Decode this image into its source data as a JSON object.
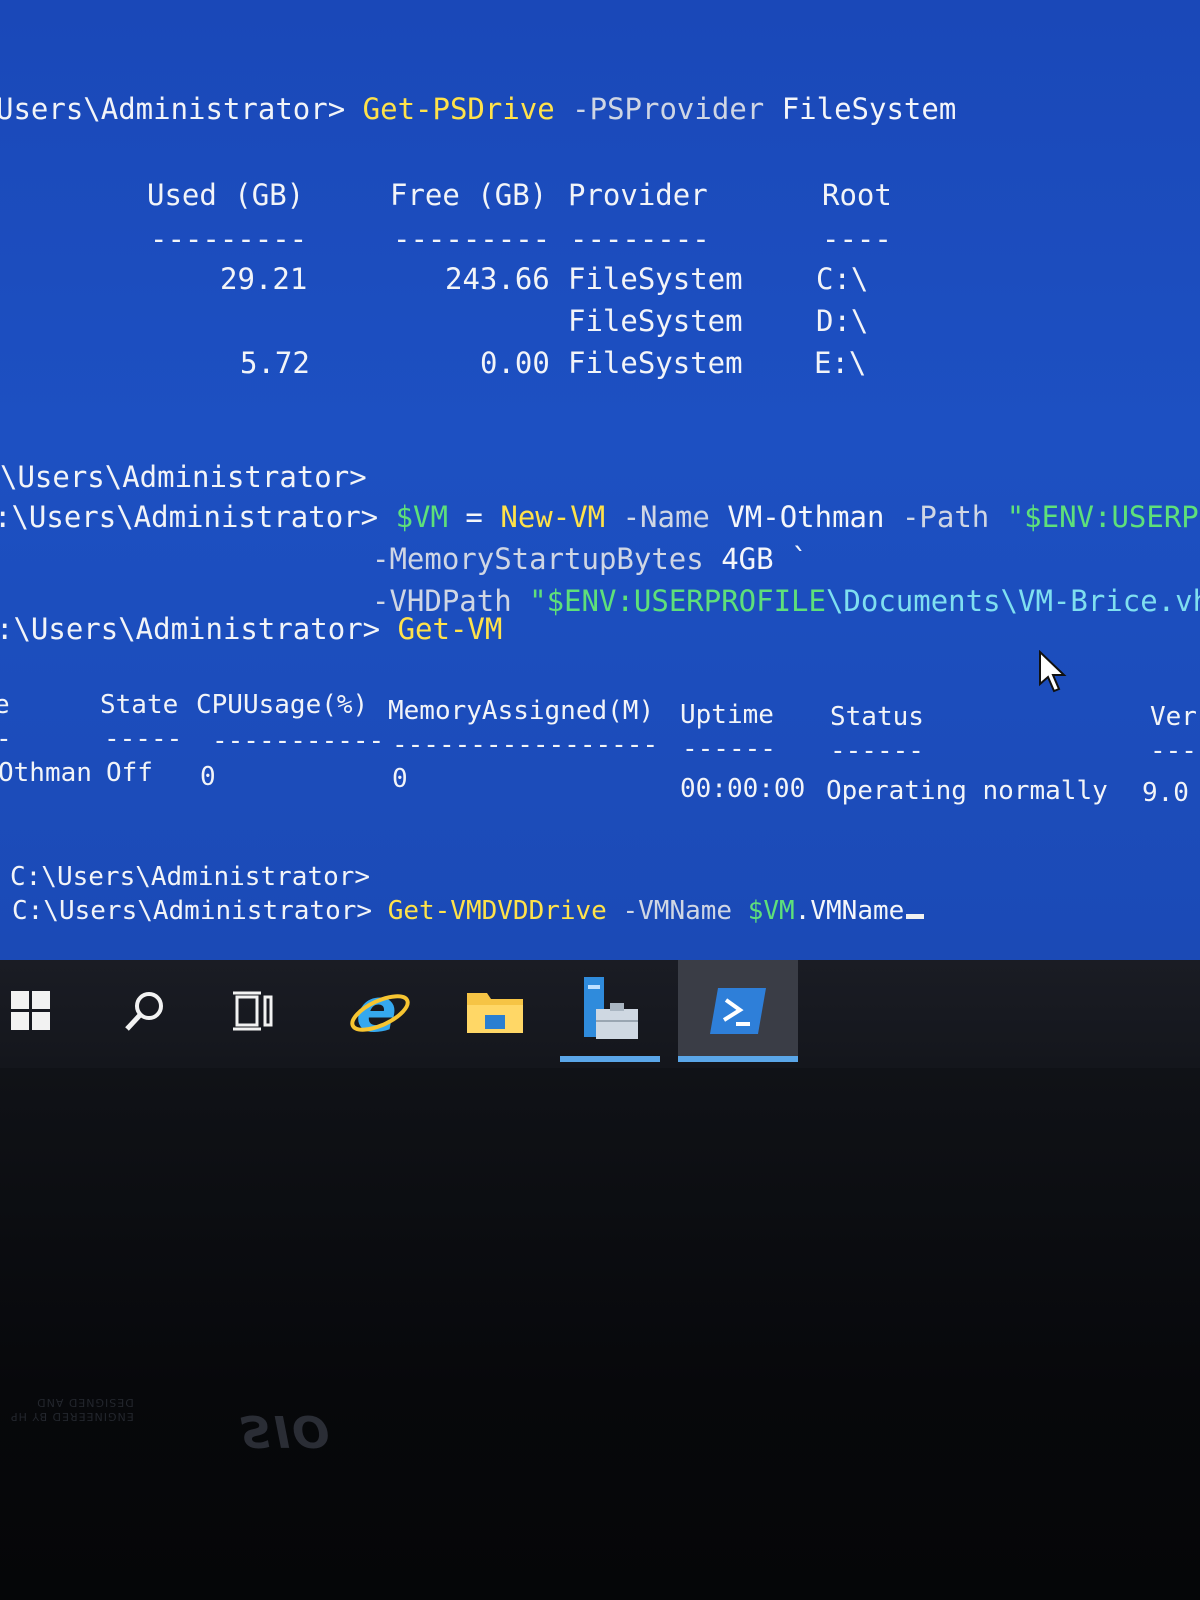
{
  "terminal": {
    "psdrive": {
      "prompt": "Users\\Administrator> ",
      "cmd": "Get-PSDrive",
      "param": " -PSProvider ",
      "arg": "FileSystem",
      "headers": {
        "used": "Used (GB)",
        "free": "Free (GB)",
        "provider": "Provider",
        "root": "Root"
      },
      "separators": {
        "used": "---------",
        "free": "---------",
        "provider": "--------",
        "root": "----"
      },
      "rows": [
        {
          "used": "29.21",
          "free": "243.66",
          "provider": "FileSystem",
          "root": "C:\\"
        },
        {
          "used": "",
          "free": "",
          "provider": "FileSystem",
          "root": "D:\\"
        },
        {
          "used": "5.72",
          "free": "0.00",
          "provider": "FileSystem",
          "root": "E:\\"
        }
      ]
    },
    "blank_prompt_1": "\\Users\\Administrator>",
    "newvm": {
      "prompt": ":\\Users\\Administrator> ",
      "var": "$VM",
      "eq": " = ",
      "cmd": "New-VM",
      "p1": " -Name ",
      "a1": "VM-Othman",
      "p2": " -Path ",
      "a2": "\"$ENV:USERPROF",
      "line2_param": "-MemoryStartupBytes ",
      "line2_arg": "4GB",
      "line2_tick": " `",
      "line3_param": "-VHDPath ",
      "line3_arg_a": "\"$ENV:USERPROFILE",
      "line3_arg_b": "\\Documents\\VM-Brice.vhd"
    },
    "getvm": {
      "prompt": ":\\Users\\Administrator> ",
      "cmd": "Get-VM",
      "headers": {
        "name": "e",
        "state": "State",
        "cpu": "CPUUsage(%)",
        "mem": "MemoryAssigned(M)",
        "uptime": "Uptime",
        "status": "Status",
        "version": "Ver"
      },
      "separators": {
        "name": "-",
        "state": "-----",
        "cpu": "-----------",
        "mem": "-----------------",
        "uptime": "------",
        "status": "------",
        "version": "---"
      },
      "row": {
        "name": "Othman",
        "state": "Off",
        "cpu": "0",
        "mem": "0",
        "uptime": "00:00:00",
        "status": "Operating normally",
        "version": "9.0"
      }
    },
    "blank_prompt_2": "C:\\Users\\Administrator>",
    "current": {
      "prompt": "C:\\Users\\Administrator> ",
      "cmd": "Get-VMDVDDrive",
      "param": " -VMName ",
      "var": "$VM",
      "prop": ".VMName"
    }
  },
  "taskbar": {
    "items": [
      {
        "icon": "windows-start-icon",
        "active": false
      },
      {
        "icon": "search-icon",
        "active": false
      },
      {
        "icon": "task-view-icon",
        "active": false
      },
      {
        "icon": "internet-explorer-icon",
        "active": false
      },
      {
        "icon": "file-explorer-icon",
        "active": false
      },
      {
        "icon": "server-manager-icon",
        "active": false,
        "running": true
      },
      {
        "icon": "powershell-icon",
        "active": true,
        "running": true
      }
    ]
  },
  "bezel": {
    "brand": "SIO",
    "tag_line_1": "ENGINEERED BY HP",
    "tag_line_2": "DESIGNED AND"
  },
  "colors": {
    "terminal_bg": "#1d50c2",
    "command": "#ffe24a",
    "string": "#5ee07a",
    "text": "#f2f4f8"
  }
}
